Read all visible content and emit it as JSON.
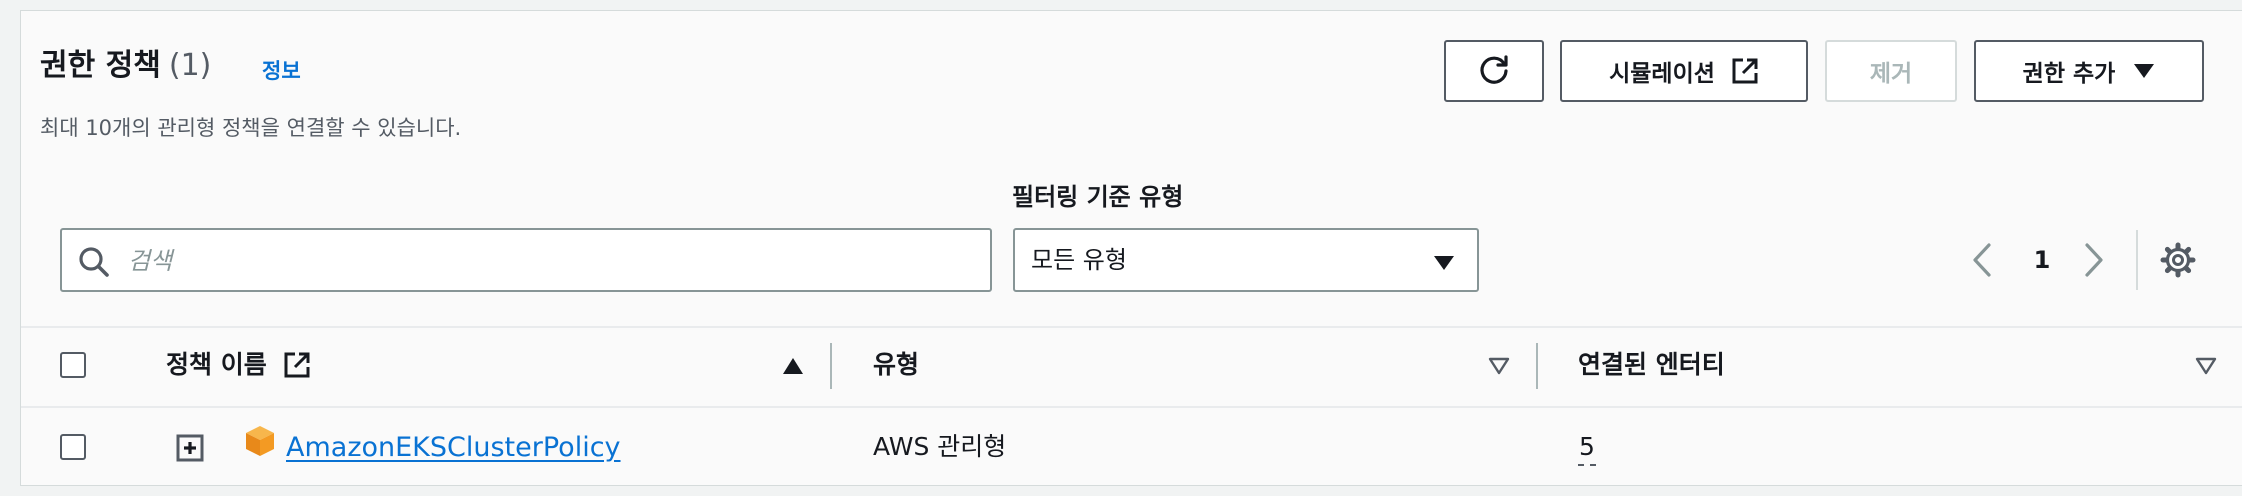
{
  "header": {
    "title": "권한 정책",
    "count": "(1)",
    "info_link": "정보",
    "description": "최대 10개의 관리형 정책을 연결할 수 있습니다."
  },
  "toolbar": {
    "refresh_icon": "refresh-icon",
    "simulate_label": "시뮬레이션",
    "remove_label": "제거",
    "add_permissions_label": "권한 추가"
  },
  "filters": {
    "search_placeholder": "검색",
    "type_label": "필터링 기준 유형",
    "type_selected": "모든 유형"
  },
  "pagination": {
    "current_page": "1"
  },
  "table": {
    "columns": [
      {
        "label": "정책 이름"
      },
      {
        "label": "유형"
      },
      {
        "label": "연결된 엔터티"
      }
    ],
    "rows": [
      {
        "name": "AmazonEKSClusterPolicy",
        "type": "AWS 관리형",
        "entities": "5"
      }
    ]
  },
  "colors": {
    "accent": "#0972d3",
    "border": "#879596",
    "panel_bg": "#fafafa",
    "page_bg": "#f1f3f3"
  }
}
